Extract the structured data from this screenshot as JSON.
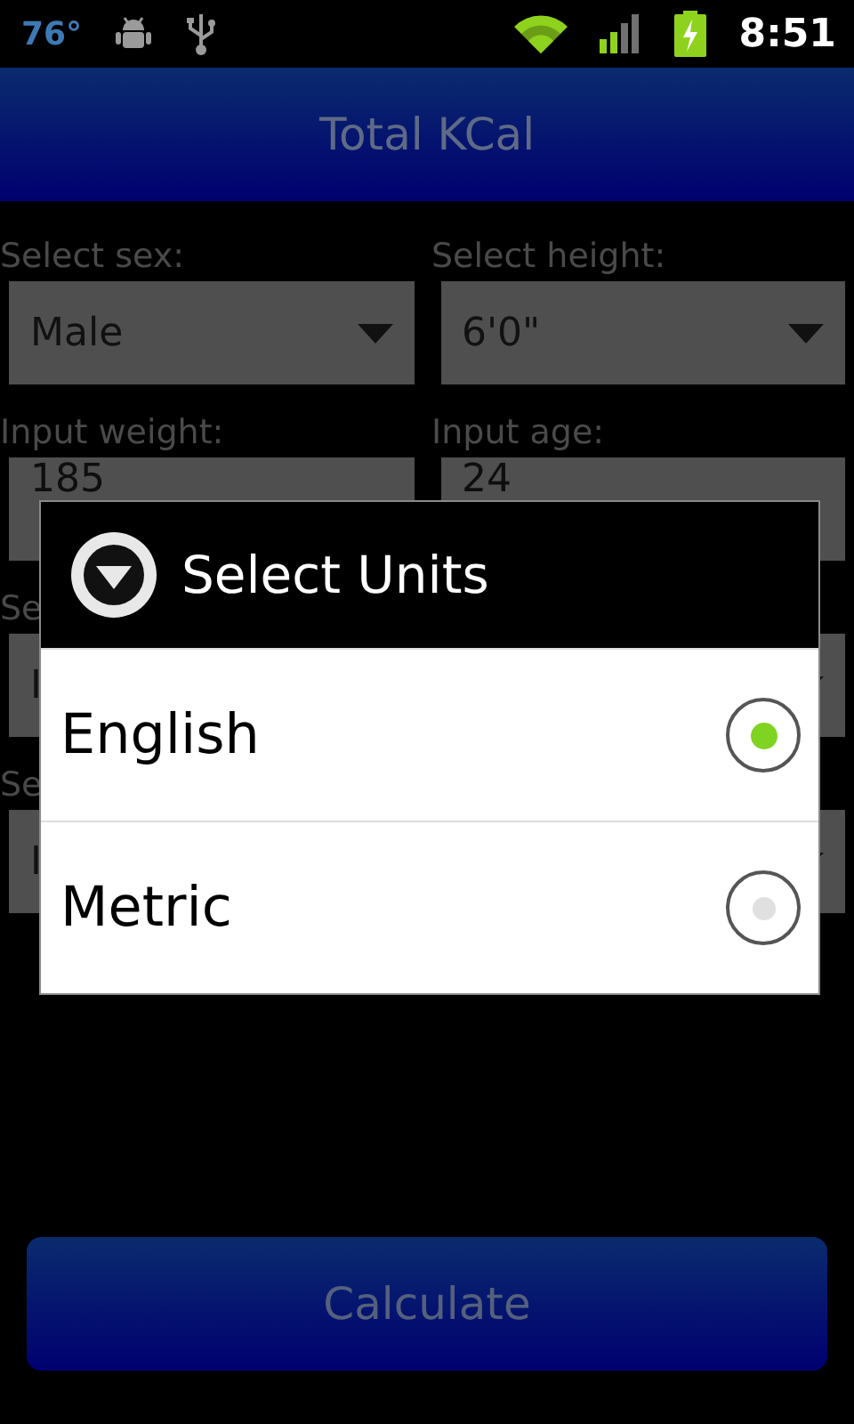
{
  "status_bar": {
    "temperature": "76°",
    "time": "8:51"
  },
  "title": "Total KCal",
  "form": {
    "fields": [
      {
        "label": "Select sex:",
        "kind": "spinner",
        "value": "Male"
      },
      {
        "label": "Select height:",
        "kind": "spinner",
        "value": "6'0\""
      },
      {
        "label": "Input weight:",
        "kind": "input",
        "value": "185"
      },
      {
        "label": "Input age:",
        "kind": "input",
        "value": "24"
      },
      {
        "label": "Se",
        "kind": "spinner",
        "value": "I"
      },
      {
        "label": "Se",
        "kind": "spinner",
        "value": "I"
      }
    ]
  },
  "calculate_button": "Calculate",
  "dialog": {
    "title": "Select Units",
    "options": [
      {
        "label": "English",
        "selected": true
      },
      {
        "label": "Metric",
        "selected": false
      }
    ]
  }
}
